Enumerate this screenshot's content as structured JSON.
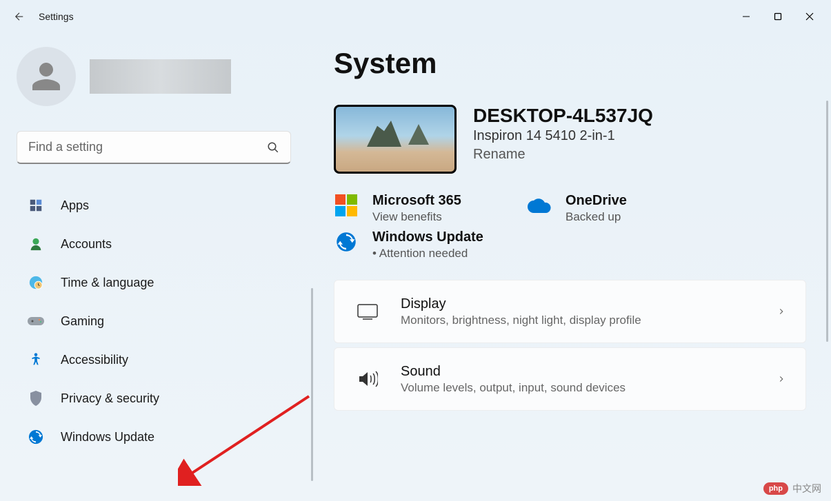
{
  "app": {
    "title": "Settings"
  },
  "search": {
    "placeholder": "Find a setting"
  },
  "sidebar": {
    "items": [
      {
        "icon": "apps",
        "label": "Apps"
      },
      {
        "icon": "accounts",
        "label": "Accounts"
      },
      {
        "icon": "time",
        "label": "Time & language"
      },
      {
        "icon": "gaming",
        "label": "Gaming"
      },
      {
        "icon": "accessibility",
        "label": "Accessibility"
      },
      {
        "icon": "privacy",
        "label": "Privacy & security"
      },
      {
        "icon": "update",
        "label": "Windows Update"
      }
    ]
  },
  "main": {
    "title": "System",
    "device": {
      "name": "DESKTOP-4L537JQ",
      "model": "Inspiron 14 5410 2-in-1",
      "rename_label": "Rename"
    },
    "status": [
      {
        "title": "Microsoft 365",
        "subtitle": "View benefits",
        "icon": "ms365"
      },
      {
        "title": "OneDrive",
        "subtitle": "Backed up",
        "icon": "onedrive"
      },
      {
        "title": "Windows Update",
        "subtitle": "Attention needed",
        "icon": "update",
        "dotted": true
      }
    ],
    "cards": [
      {
        "title": "Display",
        "subtitle": "Monitors, brightness, night light, display profile",
        "icon": "display"
      },
      {
        "title": "Sound",
        "subtitle": "Volume levels, output, input, sound devices",
        "icon": "sound"
      }
    ]
  },
  "watermark": {
    "badge": "php",
    "text": "中文网"
  }
}
